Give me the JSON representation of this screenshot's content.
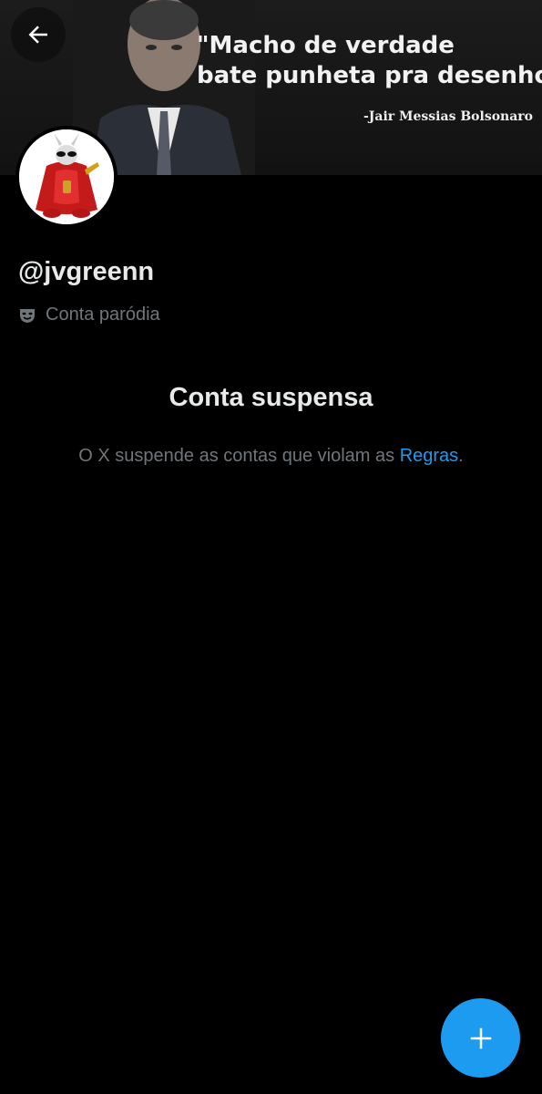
{
  "banner": {
    "quote_line1": "\"Macho de verdade",
    "quote_line2": "bate punheta pra desenho\".",
    "author": "-Jair Messias Bolsonaro"
  },
  "header": {
    "back_icon": "arrow-left-icon"
  },
  "profile": {
    "handle": "@jvgreenn",
    "parody_icon": "theater-mask-icon",
    "parody_label": "Conta paródia"
  },
  "suspension": {
    "title": "Conta suspensa",
    "description_prefix": "O X suspende as contas que violam as ",
    "rules_link": "Regras",
    "description_suffix": "."
  },
  "fab": {
    "icon": "plus-icon"
  },
  "colors": {
    "background": "#000000",
    "primary_text": "#e7e9ea",
    "secondary_text": "#71767b",
    "accent": "#1d9bf0"
  }
}
